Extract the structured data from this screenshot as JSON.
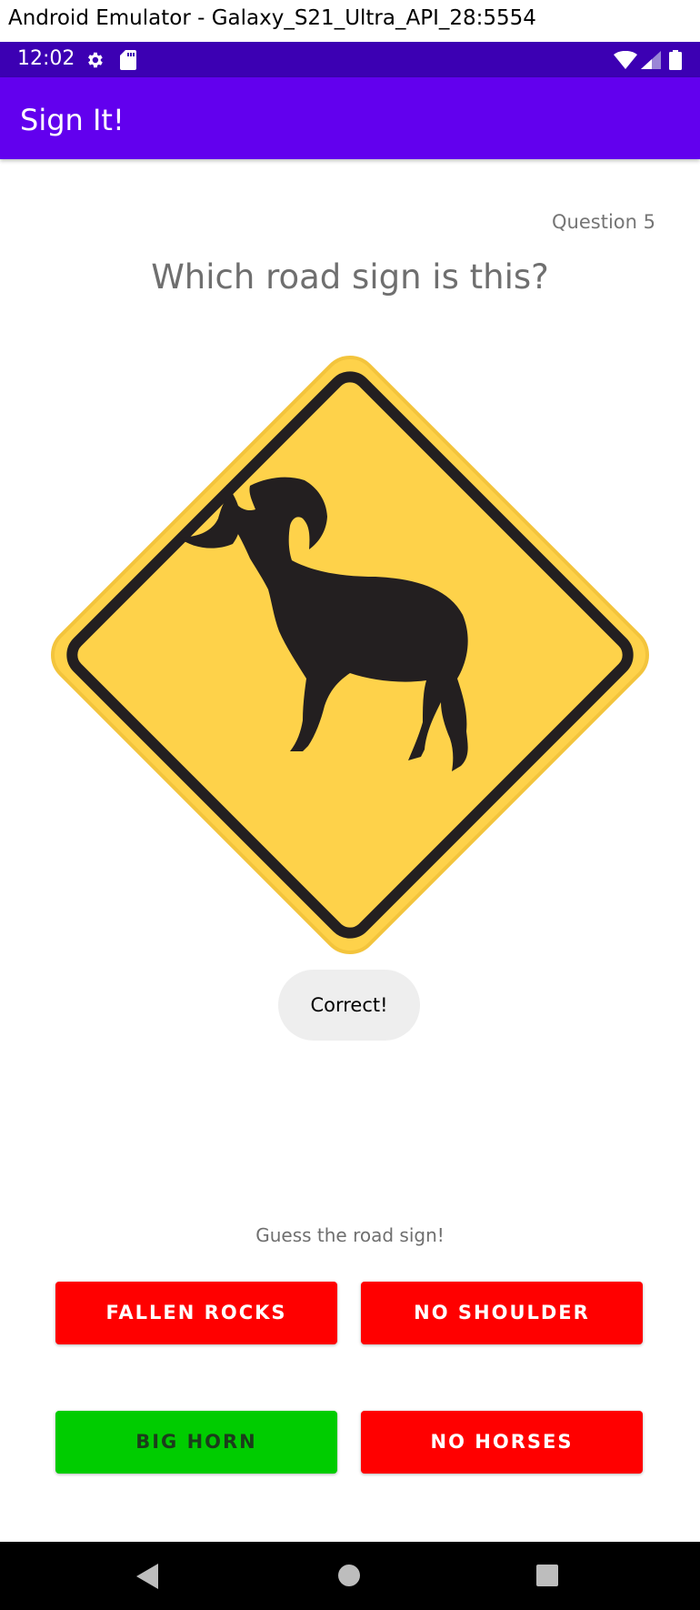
{
  "window": {
    "title": "Android Emulator - Galaxy_S21_Ultra_API_28:5554"
  },
  "status_bar": {
    "time": "12:02",
    "icons": [
      "gear-icon",
      "sd-card-icon",
      "wifi-icon",
      "signal-icon",
      "battery-icon"
    ],
    "background": "#3c00b3"
  },
  "app_bar": {
    "title": "Sign It!",
    "background": "#6200ee"
  },
  "quiz": {
    "question_number": "Question 5",
    "question": "Which road sign is this?",
    "sign_image": "big-horn-sheep-crossing-sign",
    "toast": "Correct!",
    "hint": "Guess the road sign!",
    "answers": [
      {
        "label": "FALLEN ROCKS",
        "state": "incorrect",
        "color": "#ff0000"
      },
      {
        "label": "NO SHOULDER",
        "state": "incorrect",
        "color": "#ff0000"
      },
      {
        "label": "BIG HORN",
        "state": "correct",
        "color": "#00cc00"
      },
      {
        "label": "NO HORSES",
        "state": "incorrect",
        "color": "#ff0000"
      }
    ]
  },
  "nav_bar": {
    "icons": [
      "back-icon",
      "home-icon",
      "recents-icon"
    ]
  }
}
